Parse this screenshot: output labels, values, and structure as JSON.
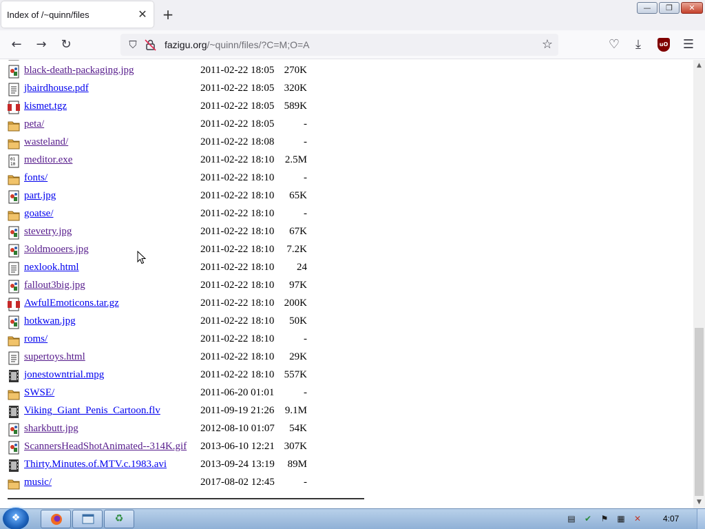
{
  "browser": {
    "tab_title": "Index of /~quinn/files",
    "close_tab_glyph": "✕",
    "new_tab_glyph": "+",
    "url_domain": "fazigu.org",
    "url_path": "/~quinn/files/?C=M;O=A"
  },
  "window_controls": {
    "minimize": "—",
    "maximize": "❐",
    "close": "✕"
  },
  "listing": [
    {
      "name": "black-death-packaging.jpg",
      "date": "2011-02-22 18:05",
      "size": "270K",
      "type": "image",
      "visited": true
    },
    {
      "name": "jbairdhouse.pdf",
      "date": "2011-02-22 18:05",
      "size": "320K",
      "type": "text",
      "visited": false
    },
    {
      "name": "kismet.tgz",
      "date": "2011-02-22 18:05",
      "size": "589K",
      "type": "compressed",
      "visited": false
    },
    {
      "name": "peta/",
      "date": "2011-02-22 18:05",
      "size": "-",
      "type": "folder",
      "visited": true
    },
    {
      "name": "wasteland/",
      "date": "2011-02-22 18:08",
      "size": "-",
      "type": "folder",
      "visited": true
    },
    {
      "name": "meditor.exe",
      "date": "2011-02-22 18:10",
      "size": "2.5M",
      "type": "binary",
      "visited": true
    },
    {
      "name": "fonts/",
      "date": "2011-02-22 18:10",
      "size": "-",
      "type": "folder",
      "visited": false
    },
    {
      "name": "part.jpg",
      "date": "2011-02-22 18:10",
      "size": "65K",
      "type": "image",
      "visited": false
    },
    {
      "name": "goatse/",
      "date": "2011-02-22 18:10",
      "size": "-",
      "type": "folder",
      "visited": false
    },
    {
      "name": "stevetry.jpg",
      "date": "2011-02-22 18:10",
      "size": "67K",
      "type": "image",
      "visited": true
    },
    {
      "name": "3oldmooers.jpg",
      "date": "2011-02-22 18:10",
      "size": "7.2K",
      "type": "image",
      "visited": true
    },
    {
      "name": "nexlook.html",
      "date": "2011-02-22 18:10",
      "size": "24",
      "type": "text",
      "visited": false
    },
    {
      "name": "fallout3big.jpg",
      "date": "2011-02-22 18:10",
      "size": "97K",
      "type": "image",
      "visited": true
    },
    {
      "name": "AwfulEmoticons.tar.gz",
      "date": "2011-02-22 18:10",
      "size": "200K",
      "type": "compressed",
      "visited": false
    },
    {
      "name": "hotkwan.jpg",
      "date": "2011-02-22 18:10",
      "size": "50K",
      "type": "image",
      "visited": false
    },
    {
      "name": "roms/",
      "date": "2011-02-22 18:10",
      "size": "-",
      "type": "folder",
      "visited": false
    },
    {
      "name": "supertoys.html",
      "date": "2011-02-22 18:10",
      "size": "29K",
      "type": "text",
      "visited": true
    },
    {
      "name": "jonestowntrial.mpg",
      "date": "2011-02-22 18:10",
      "size": "557K",
      "type": "movie",
      "visited": false
    },
    {
      "name": "SWSE/",
      "date": "2011-06-20 01:01",
      "size": "-",
      "type": "folder",
      "visited": false
    },
    {
      "name": "Viking_Giant_Penis_Cartoon.flv",
      "date": "2011-09-19 21:26",
      "size": "9.1M",
      "type": "movie",
      "visited": false
    },
    {
      "name": "sharkbutt.jpg",
      "date": "2012-08-10 01:07",
      "size": "54K",
      "type": "image",
      "visited": true
    },
    {
      "name": "ScannersHeadShotAnimated--314K.gif",
      "date": "2013-06-10 12:21",
      "size": "307K",
      "type": "image",
      "visited": true
    },
    {
      "name": "Thirty.Minutes.of.MTV.c.1983.avi",
      "date": "2013-09-24 13:19",
      "size": "89M",
      "type": "movie",
      "visited": false
    },
    {
      "name": "music/",
      "date": "2017-08-02 12:45",
      "size": "-",
      "type": "folder",
      "visited": false
    }
  ],
  "taskbar": {
    "clock": "4:07",
    "apps": [
      "firefox-icon",
      "window-icon",
      "recycle-icon"
    ]
  },
  "colors": {
    "link_visited": "#551a8b",
    "link_unvisited": "#0000ee",
    "folder": "#e8b04a",
    "taskbar": "#a9c3e4"
  }
}
